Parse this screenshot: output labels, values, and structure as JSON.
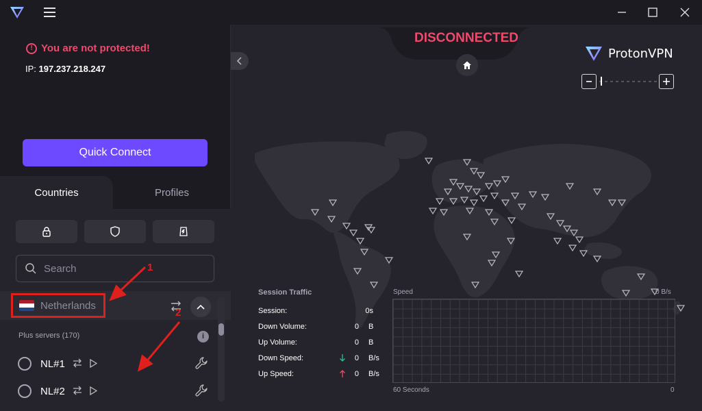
{
  "status": {
    "warning": "You are not protected!",
    "ip_label": "IP:",
    "ip_value": "197.237.218.247",
    "connection": "DISCONNECTED"
  },
  "sidebar": {
    "quick_connect": "Quick Connect",
    "tabs": [
      {
        "label": "Countries",
        "active": true
      },
      {
        "label": "Profiles",
        "active": false
      }
    ],
    "search_placeholder": "Search",
    "country": {
      "name": "Netherlands",
      "plus_servers": "Plus servers (170)"
    },
    "servers": [
      {
        "name": "NL#1"
      },
      {
        "name": "NL#2"
      }
    ]
  },
  "brand": {
    "name_a": "Proton",
    "name_b": "VPN"
  },
  "session": {
    "title": "Session Traffic",
    "rows": [
      {
        "label": "Session:",
        "value": "0s",
        "unit": ""
      },
      {
        "label": "Down Volume:",
        "value": "0",
        "unit": "B"
      },
      {
        "label": "Up Volume:",
        "value": "0",
        "unit": "B"
      },
      {
        "label": "Down Speed:",
        "value": "0",
        "unit": "B/s"
      },
      {
        "label": "Up Speed:",
        "value": "0",
        "unit": "B/s"
      }
    ],
    "speed_label": "Speed",
    "speed_value": "0 B/s",
    "seconds_label": "60 Seconds",
    "zero_label": "0"
  },
  "annotations": {
    "marker1": "1",
    "marker2": "2"
  },
  "colors": {
    "accent": "#6d4aff",
    "danger": "#f0496b",
    "annotation": "#e0201c",
    "down_arrow": "#1ec69a",
    "up_arrow": "#f0496b"
  }
}
